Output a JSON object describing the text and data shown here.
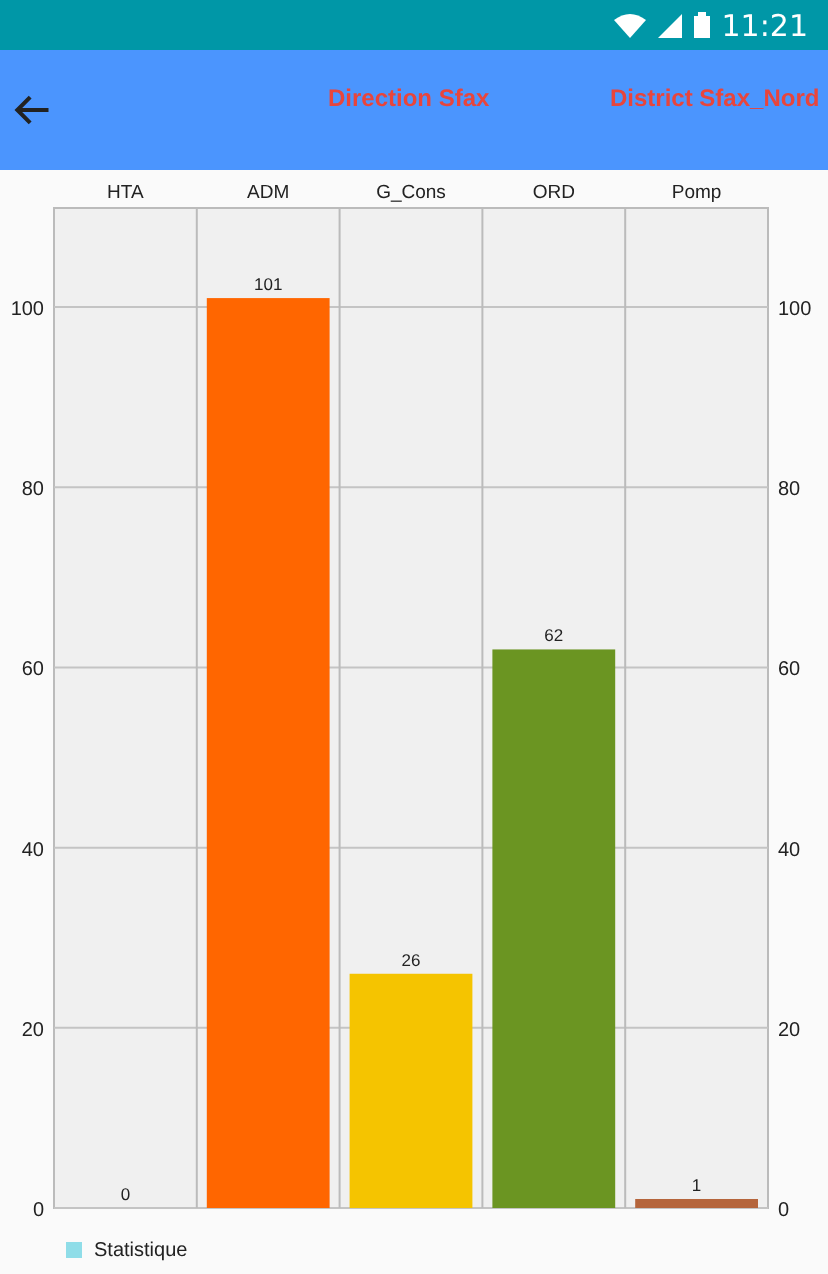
{
  "status_bar": {
    "time": "11:21"
  },
  "toolbar": {
    "title": "Direction Sfax",
    "subtitle": "District Sfax_Nord"
  },
  "chart": {
    "chart_data": {
      "type": "bar",
      "categories": [
        "HTA",
        "ADM",
        "G_Cons",
        "ORD",
        "Pomp"
      ],
      "series": [
        {
          "name": "Statistique",
          "color": "#8fdde8",
          "values": [
            0,
            null,
            null,
            null,
            null
          ]
        },
        {
          "color": "#ff6600",
          "values": [
            null,
            101,
            null,
            null,
            null
          ]
        },
        {
          "color": "#f5c400",
          "values": [
            null,
            null,
            26,
            null,
            null
          ]
        },
        {
          "color": "#6b9522",
          "values": [
            null,
            null,
            null,
            62,
            null
          ]
        },
        {
          "color": "#b5653c",
          "values": [
            null,
            null,
            null,
            null,
            1
          ]
        }
      ],
      "stacked": true,
      "grid": true,
      "ylim": [
        0,
        111
      ],
      "yticks": [
        0,
        20,
        40,
        60,
        80,
        100
      ],
      "data_labels": true
    },
    "right_axis_labels": [
      "100",
      "80",
      "60",
      "40",
      "20",
      "0"
    ]
  }
}
